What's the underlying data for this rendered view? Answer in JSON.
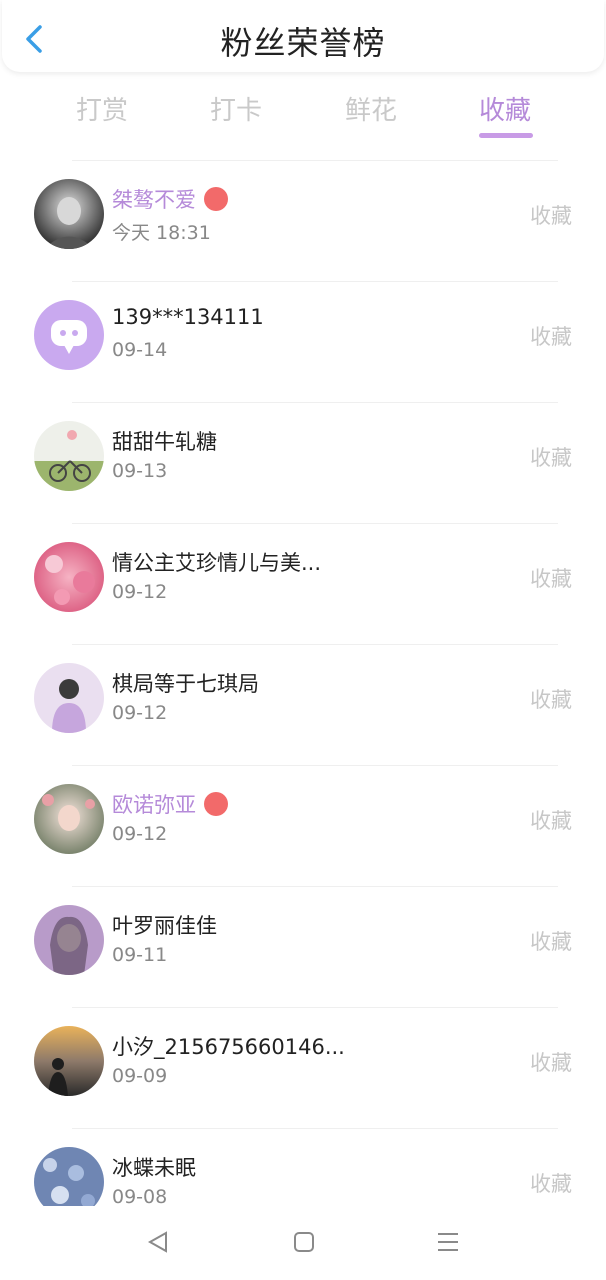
{
  "header": {
    "title": "粉丝荣誉榜"
  },
  "tabs": [
    {
      "label": "打赏"
    },
    {
      "label": "打卡"
    },
    {
      "label": "鲜花"
    },
    {
      "label": "收藏"
    }
  ],
  "active_tab": "收藏",
  "colors": {
    "accent": "#b58ad9",
    "underline": "#c89be6",
    "badge": "#f26a6a",
    "back": "#3a9ee6"
  },
  "fans": [
    {
      "name": "桀骜不爱",
      "date": "今天 18:31",
      "action": "收藏",
      "vip": true
    },
    {
      "name": "139***134111",
      "date": "09-14",
      "action": "收藏",
      "vip": false
    },
    {
      "name": "甜甜牛轧糖",
      "date": "09-13",
      "action": "收藏",
      "vip": false
    },
    {
      "name": "情公主艾珍情儿与美...",
      "date": "09-12",
      "action": "收藏",
      "vip": false
    },
    {
      "name": "棋局等于七琪局",
      "date": "09-12",
      "action": "收藏",
      "vip": false
    },
    {
      "name": "欧诺弥亚",
      "date": "09-12",
      "action": "收藏",
      "vip": true
    },
    {
      "name": "叶罗丽佳佳",
      "date": "09-11",
      "action": "收藏",
      "vip": false
    },
    {
      "name": "小汐_215675660146...",
      "date": "09-09",
      "action": "收藏",
      "vip": false
    },
    {
      "name": "冰蝶未眠",
      "date": "09-08",
      "action": "收藏",
      "vip": false
    }
  ],
  "navbar": {
    "icons": [
      "back-triangle-icon",
      "home-square-icon",
      "menu-lines-icon"
    ]
  }
}
